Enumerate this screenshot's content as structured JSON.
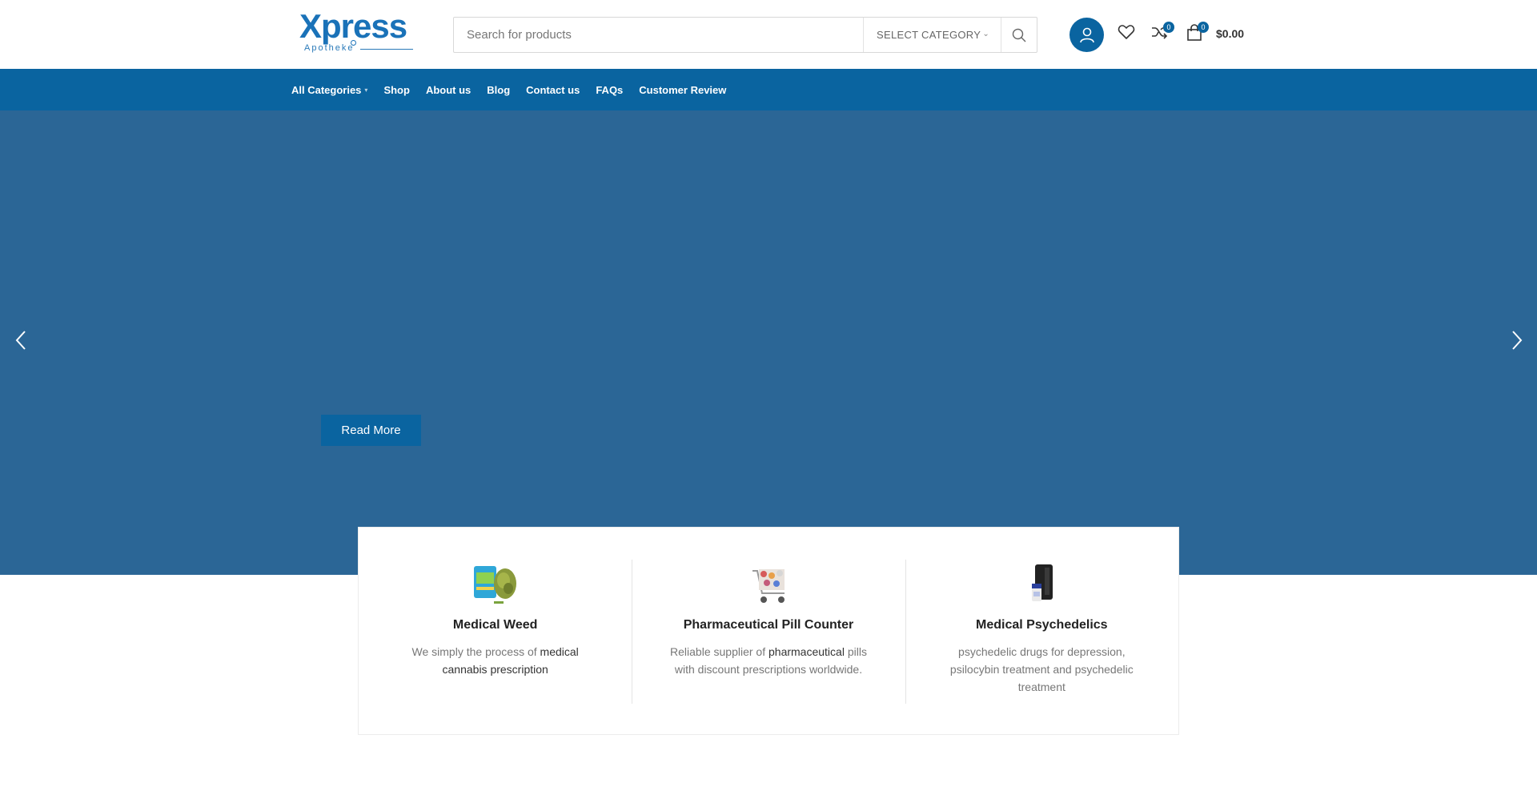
{
  "header": {
    "logo": {
      "main": "Xpress",
      "sub": "Apotheke"
    },
    "search": {
      "placeholder": "Search for products",
      "category": "SELECT CATEGORY"
    },
    "compare_count": "0",
    "cart_count": "0",
    "cart_total": "$0.00"
  },
  "nav": {
    "items": [
      "All Categories",
      "Shop",
      "About us",
      "Blog",
      "Contact us",
      "FAQs",
      "Customer Review"
    ]
  },
  "hero": {
    "read_more": "Read More"
  },
  "features": [
    {
      "title": "Medical Weed",
      "desc_pre": "We simply the process of ",
      "desc_hl": "medical cannabis prescription",
      "desc_post": ""
    },
    {
      "title": "Pharmaceutical Pill Counter",
      "desc_pre": "Reliable supplier of ",
      "desc_hl": "pharmaceutical",
      "desc_post": " pills with discount prescriptions worldwide."
    },
    {
      "title": "Medical Psychedelics",
      "desc_pre": "psychedelic drugs for depression, psilocybin treatment and psychedelic treatment",
      "desc_hl": "",
      "desc_post": ""
    }
  ],
  "colors": {
    "brand": "#0a64a0",
    "hero_bg": "#2b6696"
  }
}
